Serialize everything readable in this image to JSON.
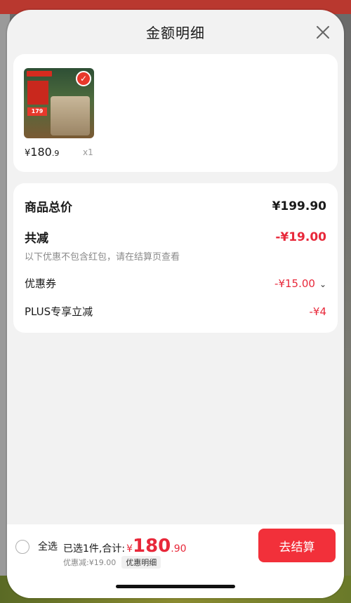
{
  "header": {
    "title": "金额明细",
    "close_icon": "close-icon"
  },
  "product": {
    "thumb_promo_price": "179",
    "price_symbol": "¥",
    "price_int": "180",
    "price_dec": ".9",
    "qty": "x1"
  },
  "summary": {
    "total_label": "商品总价",
    "total_value": "¥199.90",
    "reduce_label": "共减",
    "reduce_value": "-¥19.00",
    "reduce_note": "以下优惠不包含红包，请在结算页查看",
    "coupon_label": "优惠券",
    "coupon_value": "-¥15.00",
    "plus_label": "PLUS专享立减",
    "plus_value": "-¥4"
  },
  "footer": {
    "select_all": "全选",
    "selected_text": "已选1件,合计:",
    "total_symbol": "¥",
    "total_int": "180",
    "total_dec": ".90",
    "discount_text": "优惠减:¥19.00",
    "discount_detail": "优惠明细",
    "checkout_label": "去结算"
  },
  "colors": {
    "accent_red": "#e8283a",
    "checkout_bg": "#f2303a"
  }
}
